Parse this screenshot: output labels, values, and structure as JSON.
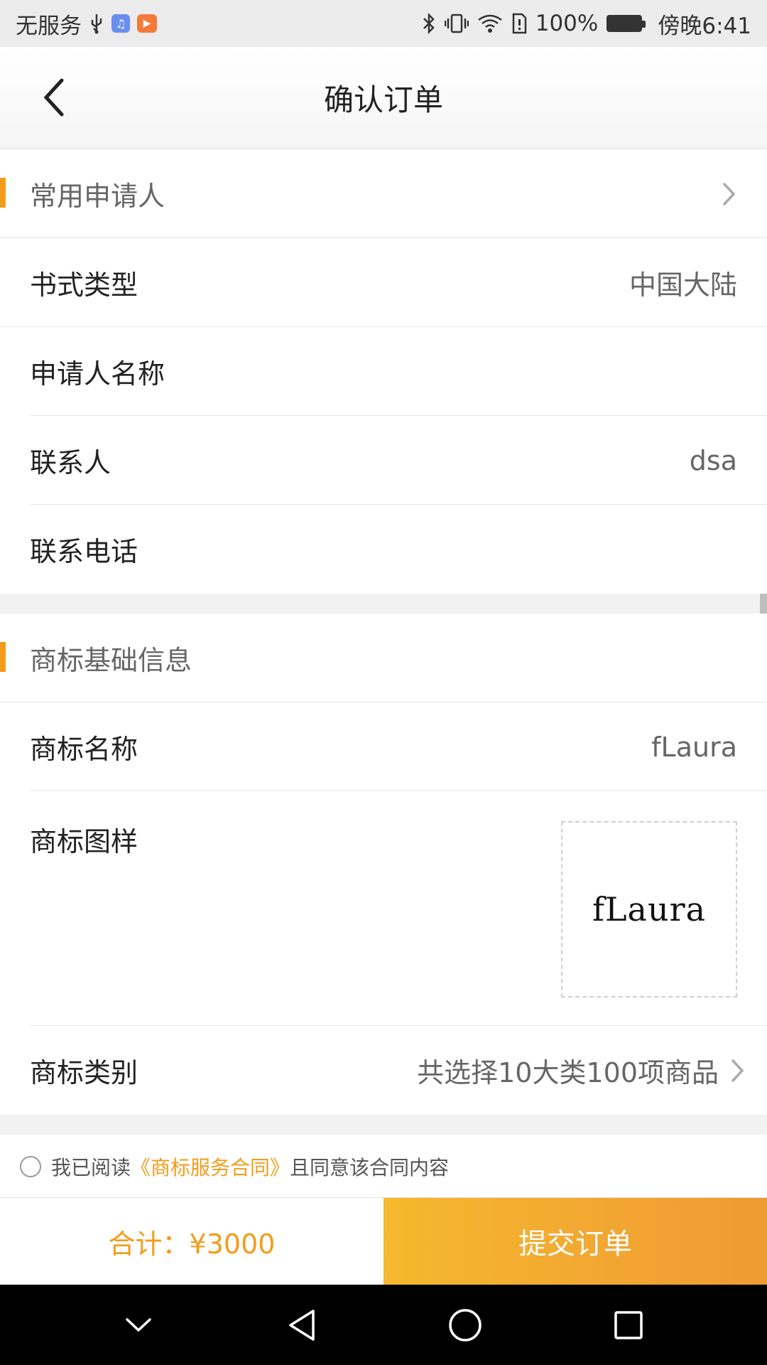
{
  "status_bar": {
    "carrier": "无服务",
    "battery_pct": "100%",
    "time": "傍晚6:41"
  },
  "header": {
    "title": "确认订单"
  },
  "applicant_section": {
    "heading": "常用申请人",
    "rows": [
      {
        "label": "书式类型",
        "value": "中国大陆"
      },
      {
        "label": "申请人名称",
        "value": ""
      },
      {
        "label": "联系人",
        "value": "dsa"
      },
      {
        "label": "联系电话",
        "value": ""
      }
    ]
  },
  "trademark_section": {
    "heading": "商标基础信息",
    "name_label": "商标名称",
    "name_value": "fLaura",
    "sample_label": "商标图样",
    "sample_text": "fLaura",
    "category_label": "商标类别",
    "category_value": "共选择10大类100项商品"
  },
  "agreement": {
    "prefix": "我已阅读",
    "link": "《商标服务合同》",
    "suffix": "且同意该合同内容"
  },
  "bottom_bar": {
    "total": "合计：¥3000",
    "submit": "提交订单"
  },
  "colors": {
    "accent": "#f39c1a",
    "submit_start": "#f5b82e",
    "submit_end": "#f09a34"
  }
}
